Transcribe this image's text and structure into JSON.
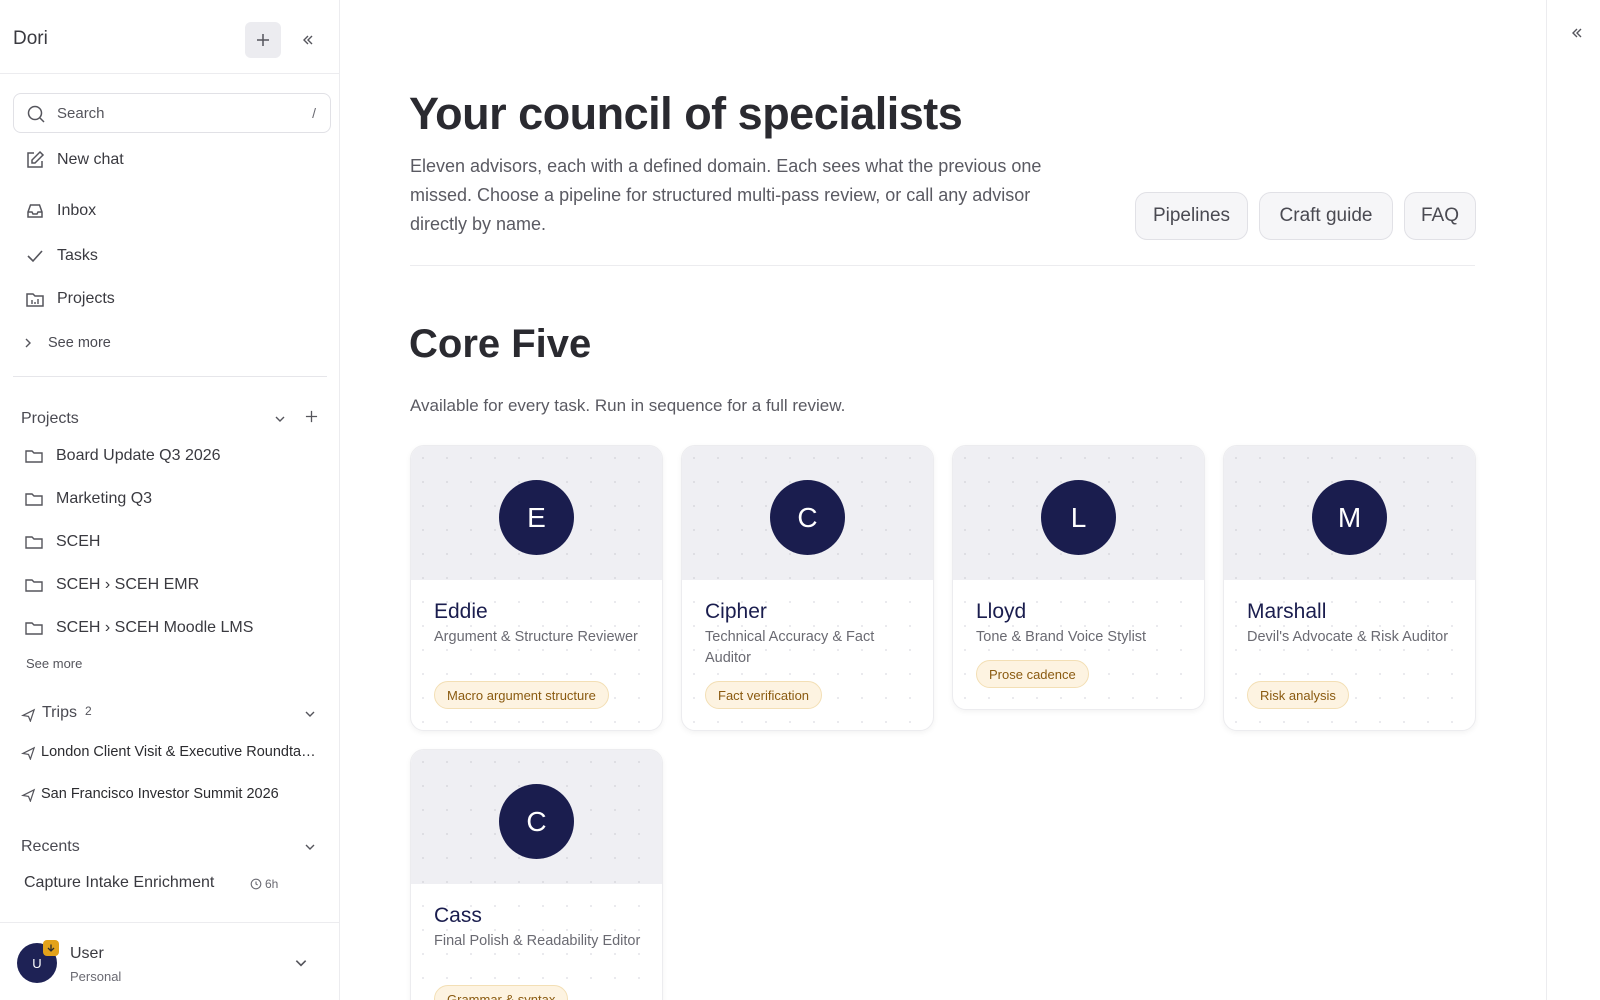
{
  "app": {
    "brand": "Dori"
  },
  "sidebar": {
    "search": {
      "label": "Search",
      "shortcut": "/"
    },
    "nav": [
      {
        "label": "New chat",
        "icon": "edit-icon"
      },
      {
        "label": "Inbox",
        "icon": "inbox-icon"
      },
      {
        "label": "Tasks",
        "icon": "check-icon"
      },
      {
        "label": "Projects",
        "icon": "projects-icon"
      }
    ],
    "see_more": "See more",
    "projects": {
      "title": "Projects",
      "items": [
        "Board Update Q3 2026",
        "Marketing Q3",
        "SCEH",
        "SCEH › SCEH EMR",
        "SCEH › SCEH Moodle LMS"
      ],
      "see_more": "See more"
    },
    "trips": {
      "title": "Trips",
      "count": "2",
      "items": [
        "London Client Visit & Executive Roundtable",
        "San Francisco Investor Summit 2026"
      ]
    },
    "recents": {
      "title": "Recents",
      "items": [
        {
          "label": "Capture Intake Enrichment",
          "time": "6h"
        }
      ]
    },
    "user": {
      "initial": "U",
      "name": "User",
      "plan": "Personal"
    }
  },
  "main": {
    "title": "Your council of specialists",
    "description": "Eleven advisors, each with a defined domain. Each sees what the previous one missed. Choose a pipeline for structured multi-pass review, or call any advisor directly by name.",
    "buttons": [
      "Pipelines",
      "Craft guide",
      "FAQ"
    ],
    "section": {
      "title": "Core Five",
      "subtitle": "Available for every task. Run in sequence for a full review."
    },
    "advisors": [
      {
        "initial": "E",
        "name": "Eddie",
        "role": "Argument & Structure Reviewer",
        "tag": "Macro argument structure"
      },
      {
        "initial": "C",
        "name": "Cipher",
        "role": "Technical Accuracy & Fact Auditor",
        "tag": "Fact verification"
      },
      {
        "initial": "L",
        "name": "Lloyd",
        "role": "Tone & Brand Voice Stylist",
        "tag": "Prose cadence"
      },
      {
        "initial": "M",
        "name": "Marshall",
        "role": "Devil's Advocate & Risk Auditor",
        "tag": "Risk analysis"
      },
      {
        "initial": "C",
        "name": "Cass",
        "role": "Final Polish & Readability Editor",
        "tag": "Grammar & syntax"
      }
    ]
  },
  "colors": {
    "avatar": "#1a1d4e",
    "tag_bg": "#fdf3e1",
    "tag_text": "#8a5a10",
    "badge": "#e3a21a"
  }
}
